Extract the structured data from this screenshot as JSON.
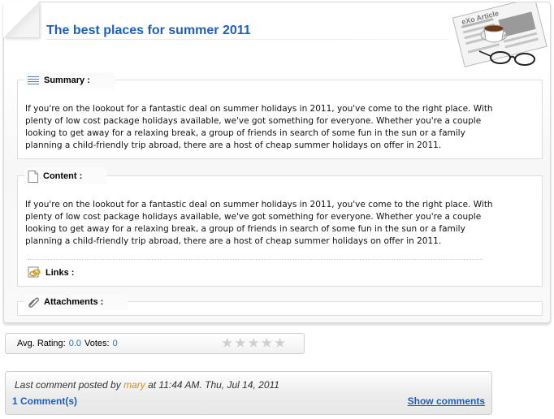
{
  "article": {
    "title": "The best places for summer 2011",
    "badge_text": "eXo Article"
  },
  "summary": {
    "label": "Summary :",
    "text": "If you're on the lookout for a fantastic deal on summer holidays in 2011, you've come to the right place. With plenty of low cost package holidays available, we've got something for everyone. Whether you're a couple looking to get away for a relaxing break, a group of friends in search of some fun in the sun or a family planning a child-friendly trip abroad, there are a host of cheap summer holidays on offer in 2011."
  },
  "content": {
    "label": "Content :",
    "text": "If you're on the lookout for a fantastic deal on summer holidays in 2011, you've come to the right place. With plenty of low cost package holidays available, we've got something for everyone. Whether you're a couple looking to get away for a relaxing break, a group of friends in search of some fun in the sun or a family planning a child-friendly trip abroad, there are a host of cheap summer holidays on offer in 2011.",
    "links_label": "Links :"
  },
  "attachments": {
    "label": "Attachments :"
  },
  "rating": {
    "avg_label": "Avg. Rating:",
    "avg_value": "0.0",
    "votes_label": "Votes:",
    "votes_value": "0",
    "stars_total": 5,
    "stars_filled": 0
  },
  "comments": {
    "prefix": "Last comment posted by",
    "author": "mary",
    "suffix": "at 11:44 AM. Thu, Jul 14, 2011",
    "count_label": "1 Comment(s)",
    "show_label": "Show comments"
  },
  "colors": {
    "title": "#1e5fb8",
    "link": "#2a6fc1",
    "author": "#e08a1e",
    "star_empty": "#cfcfcf"
  }
}
